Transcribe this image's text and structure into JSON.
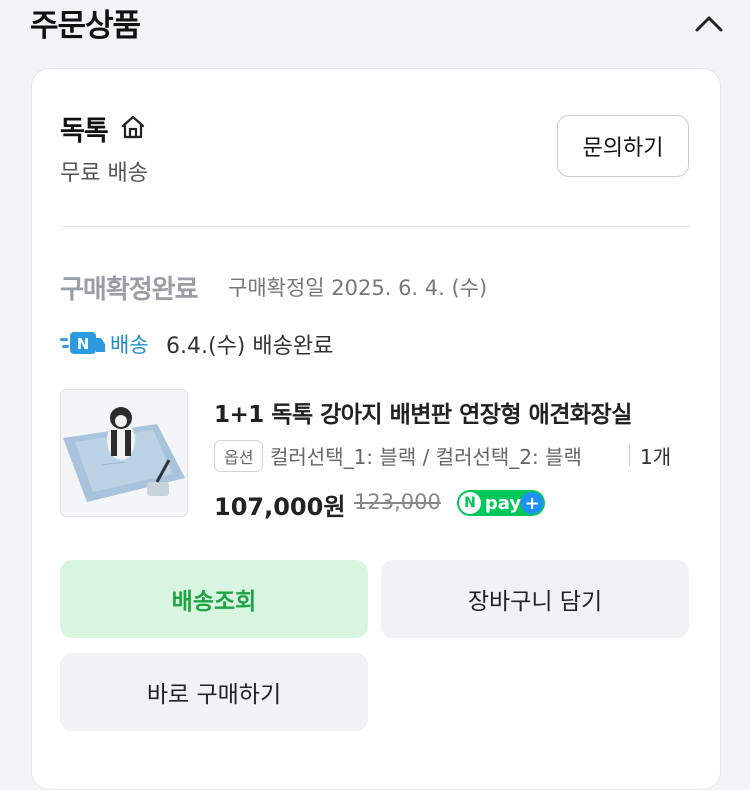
{
  "header": {
    "title": "주문상품"
  },
  "seller": {
    "name": "독톡",
    "shipping": "무료 배송",
    "inquiry_label": "문의하기"
  },
  "status": {
    "main": "구매확정완료",
    "sub": "구매확정일 2025. 6. 4. (수)"
  },
  "delivery": {
    "badge_label": "배송",
    "status": "6.4.(수) 배송완료"
  },
  "product": {
    "name": "1+1 독톡 강아지 배변판 연장형 애견화장실",
    "option_badge": "옵션",
    "option_text": "컬러선택_1: 블랙 / 컬러선택_2: 블랙",
    "quantity": "1개",
    "price": "107,000원",
    "original_price": "123,000",
    "npay_text": "pay"
  },
  "buttons": {
    "track": "배송조회",
    "cart": "장바구니 담기",
    "buy": "바로 구매하기"
  },
  "colors": {
    "accent_green": "#03c75a",
    "track_bg": "#d8f5df",
    "delivery_blue": "#1e90c8"
  }
}
